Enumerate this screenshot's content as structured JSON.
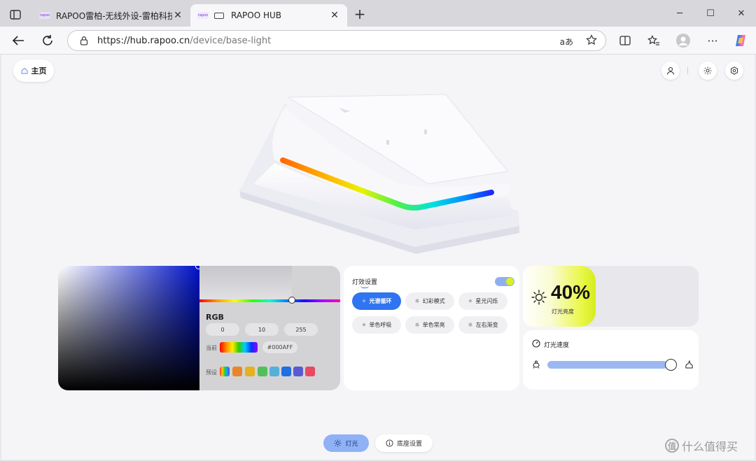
{
  "browser": {
    "tabs": [
      {
        "title": "RAPOO雷柏-无线外设-雷柏科技",
        "favicon": "rapoo",
        "active": false
      },
      {
        "title": "RAPOO HUB",
        "favicon": "rapoo",
        "active": true
      }
    ],
    "url_host": "https://hub.rapoo.cn",
    "url_path": "/device/base-light",
    "read_aloud": "aあ"
  },
  "header": {
    "home_label": "主页"
  },
  "color_picker": {
    "rgb_label": "RGB",
    "r": "0",
    "g": "10",
    "b": "255",
    "current_label": "当前",
    "hex": "#000AFF",
    "preset_label": "预设",
    "presets": [
      "rainbow",
      "#e8862a",
      "#e6b020",
      "#52c05a",
      "#55b0d8",
      "#1f6fe0",
      "#5a5ad0",
      "#e84a5f"
    ]
  },
  "effects": {
    "title": "灯效设置",
    "enabled": true,
    "modes": [
      {
        "label": "光谱循环",
        "active": true
      },
      {
        "label": "幻彩模式",
        "active": false
      },
      {
        "label": "星光闪烁",
        "active": false
      },
      {
        "label": "单色呼吸",
        "active": false
      },
      {
        "label": "单色常亮",
        "active": false
      },
      {
        "label": "左右渐变",
        "active": false
      }
    ]
  },
  "brightness": {
    "value": "40%",
    "label": "灯光亮度"
  },
  "speed": {
    "title": "灯光速度",
    "level": 0.95
  },
  "bottom_tabs": [
    {
      "label": "灯光",
      "active": true
    },
    {
      "label": "底座设置",
      "active": false
    }
  ],
  "watermark": "什么值得买",
  "colors": {
    "accent": "#2f74f0",
    "toggle_knob": "#d8f027",
    "slider_fill": "#9cb8f2"
  }
}
